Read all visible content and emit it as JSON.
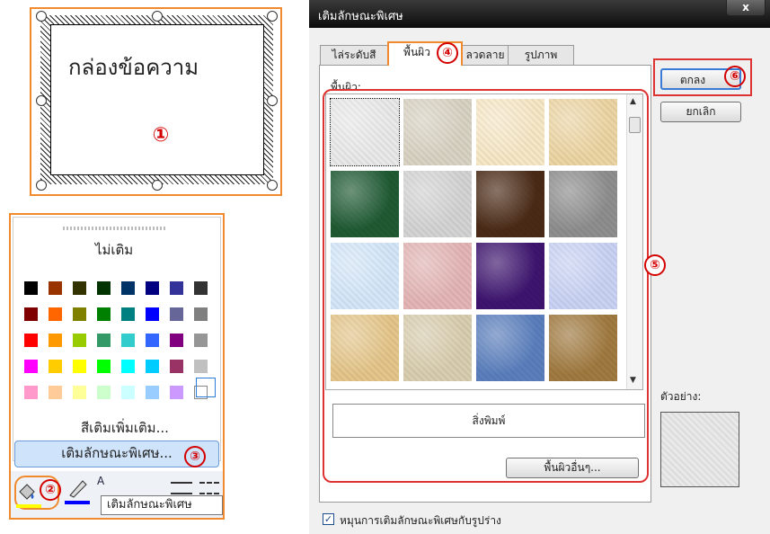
{
  "textbox": {
    "text": "กล่องข้อความ",
    "step": "①"
  },
  "color_menu": {
    "no_fill": "ไม่เติม",
    "more_colors": "สีเติมเพิ่มเติม...",
    "fill_effects": "เติมลักษณะพิเศษ...",
    "fill_effects_step": "③",
    "bucket_step": "②",
    "tooltip": "เติมลักษณะพิเศษ",
    "palette": [
      [
        "#000000",
        "#993300",
        "#333300",
        "#003300",
        "#003366",
        "#000080",
        "#333399",
        "#333333"
      ],
      [
        "#800000",
        "#ff6600",
        "#808000",
        "#008000",
        "#008080",
        "#0000ff",
        "#666699",
        "#808080"
      ],
      [
        "#ff0000",
        "#ff9900",
        "#99cc00",
        "#339966",
        "#33cccc",
        "#3366ff",
        "#800080",
        "#969696"
      ],
      [
        "#ff00ff",
        "#ffcc00",
        "#ffff00",
        "#00ff00",
        "#00ffff",
        "#00ccff",
        "#993366",
        "#c0c0c0"
      ],
      [
        "#ff99cc",
        "#ffcc99",
        "#ffff99",
        "#ccffcc",
        "#ccffff",
        "#99ccff",
        "#cc99ff",
        "#ffffff"
      ]
    ]
  },
  "dialog": {
    "title": "เติมลักษณะพิเศษ",
    "close": "x",
    "tabs": [
      "ไล่ระดับสี",
      "พื้นผิว",
      "ลวดลาย",
      "รูปภาพ"
    ],
    "tab_step": "④",
    "texture_label": "พื้นผิว:",
    "grid_step": "⑤",
    "selected_texture_name": "สิ่งพิมพ์",
    "other_texture": "พื้นผิวอื่นๆ...",
    "ok": "ตกลง",
    "ok_step": "⑥",
    "cancel": "ยกเลิก",
    "sample_label": "ตัวอย่าง:",
    "rotate_label": "หมุนการเติมลักษณะพิเศษกับรูปร่าง",
    "rotate_checked": true,
    "textures": [
      [
        "#e9e9e9",
        "#d8d2c2",
        "#f6e7c6",
        "#ecd5a4"
      ],
      [
        "#1f5a33",
        "#d3d3d3",
        "#4a2a16",
        "#8e8e8e"
      ],
      [
        "#d3e6f8",
        "#e3b5b5",
        "#3d146e",
        "#c9d2f3"
      ],
      [
        "#e4c68b",
        "#d8cdae",
        "#5b7fbd",
        "#a07a40"
      ]
    ]
  }
}
